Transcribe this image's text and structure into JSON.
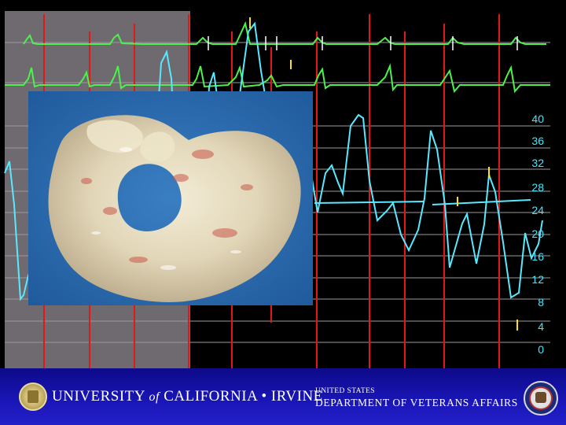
{
  "scale_labels": [
    "40",
    "36",
    "32",
    "28",
    "24",
    "20",
    "16",
    "12",
    "8",
    "4",
    "0"
  ],
  "footer": {
    "uci_name_part1": "UNIVERSITY",
    "uci_name_of": "of",
    "uci_name_part2": "CALIFORNIA • IRVINE",
    "va_line1": "UNITED STATES",
    "va_line2": "DEPARTMENT OF VETERANS AFFAIRS"
  },
  "colors": {
    "gray_panel": "#6e6a70",
    "ecg_green": "#4ef04e",
    "pressure_cyan": "#5ae8ff",
    "marker_red": "#e01818",
    "marker_yellow": "#ffe010",
    "scale_text": "#3fe8ff",
    "footer_blue": "#1a16b8"
  },
  "icons": [
    "uci-seal-icon",
    "va-seal-icon"
  ]
}
